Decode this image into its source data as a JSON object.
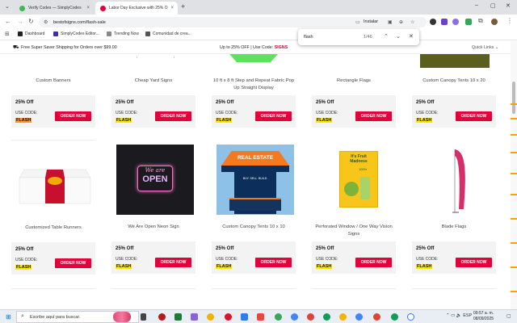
{
  "tabs": [
    {
      "title": "Verify Codes — SimplyCodes",
      "color": "#3cba54"
    },
    {
      "title": "Labor Day Exclusive with 25% O",
      "color": "#e4003b"
    }
  ],
  "address": {
    "url": "bestofsigns.com/flash-sale",
    "install_label": "Instalar"
  },
  "bookmarks": [
    {
      "label": "Dashboard",
      "color": "#222"
    },
    {
      "label": "SimplyCodes Editor...",
      "color": "#3b2ca8"
    },
    {
      "label": "Trending Now",
      "color": "#888"
    },
    {
      "label": "Comunidad de crea...",
      "color": "#555"
    }
  ],
  "find": {
    "query": "flash",
    "count": "1/46"
  },
  "site": {
    "shipping": "Free Super Saver Shipping for Orders over $99.00",
    "promo_prefix": "Up to 25% OFF | Use Code: ",
    "promo_code": "SIGNS",
    "quick_links": "Quick Links ⌄"
  },
  "offer": {
    "percent": "25% Off",
    "use_code": "USE CODE:",
    "code": "FLASH",
    "button": "ORDER NOW"
  },
  "row1_titles": [
    "Custom Banners",
    "Cheap Yard Signs",
    "10 ft x 8 ft Step and Repeat Fabric Pop Up Straight Display",
    "Rectangle Flags",
    "Custom Canopy Tents 10 x 20"
  ],
  "row2": [
    {
      "title": "Customized Table Runners",
      "image": "table-runner-image"
    },
    {
      "title": "We Are Open Neon Sign",
      "image": "neon-sign-image",
      "neon_text_1": "We are",
      "neon_text_2": "OPEN"
    },
    {
      "title": "Custom Canopy Tents 10 x 10",
      "image": "canopy-tent-image",
      "tent_text": "REAL ESTATE",
      "sign_text": "BUY. SELL. BUILD."
    },
    {
      "title": "Perforated Window / One Way Vision Signs",
      "image": "window-poster-image",
      "poster_text_1": "It's Fruit",
      "poster_text_2": "Madness",
      "poster_text_3": "100%"
    },
    {
      "title": "Blade Flags",
      "image": "blade-flag-image"
    }
  ],
  "taskbar": {
    "search_placeholder": "Escribe aquí para buscar.",
    "time": "09:57 a. m.",
    "date": "08/09/2025"
  },
  "colors": {
    "accent": "#e4003b",
    "highlight": "#ffe600",
    "current_match": "#ff9632"
  }
}
